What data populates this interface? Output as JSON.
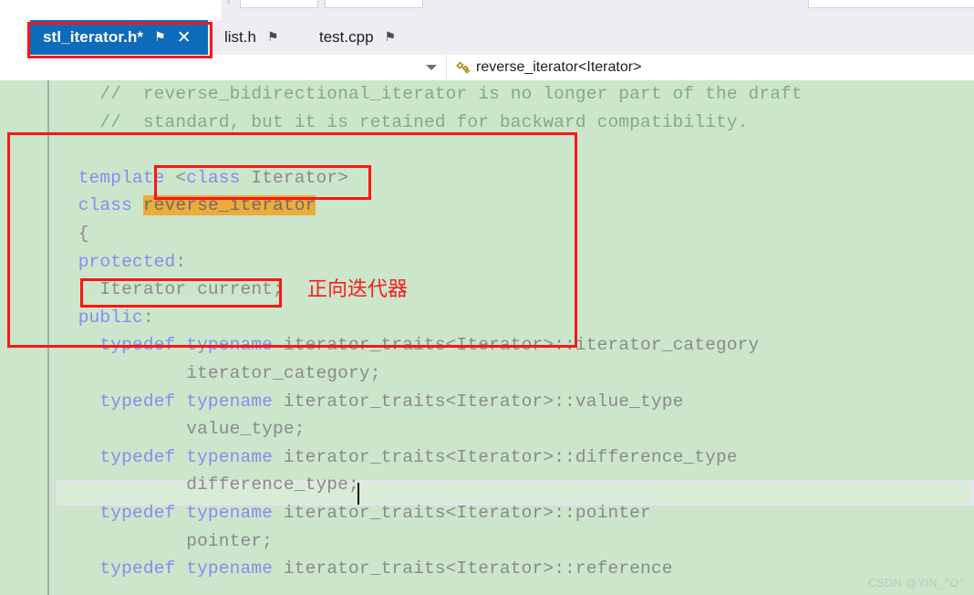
{
  "toolbar": {
    "combo_stubs": [
      "",
      "",
      ""
    ]
  },
  "tabs": {
    "items": [
      {
        "label": "stl_iterator.h*",
        "active": true,
        "pin_icon": "pin-icon",
        "close_icon": "close-icon",
        "has_close": true
      },
      {
        "label": "list.h",
        "active": false,
        "pin_icon": "pin-icon",
        "has_close": false
      },
      {
        "label": "test.cpp",
        "active": false,
        "pin_icon": "pin-icon",
        "has_close": false
      }
    ],
    "pin_glyph": "⚑",
    "close_glyph": "✕"
  },
  "navbar": {
    "scope_selector_value": "",
    "chevron_icon": "chevron-down-icon",
    "member_icon": "class-icon",
    "member_label": "reverse_iterator<Iterator>"
  },
  "editor": {
    "lines": [
      {
        "id": "l1",
        "segments": [
          {
            "t": "    //  reverse_bidirectional_iterator is no longer part of the draft",
            "c": "cmt"
          }
        ]
      },
      {
        "id": "l2",
        "segments": [
          {
            "t": "    //  standard, but it is retained for backward compatibility.",
            "c": "cmt"
          }
        ]
      },
      {
        "id": "l3",
        "segments": [
          {
            "t": "",
            "c": "id"
          }
        ]
      },
      {
        "id": "l4",
        "segments": [
          {
            "t": "  template ",
            "c": "kw"
          },
          {
            "t": "<",
            "c": "id"
          },
          {
            "t": "class",
            "c": "kw"
          },
          {
            "t": " Iterator>",
            "c": "id"
          }
        ]
      },
      {
        "id": "l5",
        "segments": [
          {
            "t": "  class ",
            "c": "kw"
          },
          {
            "t": "reverse_iterator",
            "c": "hl-orange"
          }
        ]
      },
      {
        "id": "l6",
        "segments": [
          {
            "t": "  {",
            "c": "id"
          }
        ]
      },
      {
        "id": "l7",
        "segments": [
          {
            "t": "  protected",
            "c": "kw"
          },
          {
            "t": ":",
            "c": "id"
          }
        ]
      },
      {
        "id": "l8",
        "segments": [
          {
            "t": "    Iterator current;",
            "c": "id"
          }
        ]
      },
      {
        "id": "l9",
        "segments": [
          {
            "t": "  public",
            "c": "kw"
          },
          {
            "t": ":",
            "c": "id"
          }
        ]
      },
      {
        "id": "l10",
        "segments": [
          {
            "t": "    typedef typename",
            "c": "kw"
          },
          {
            "t": " iterator_traits<Iterator>::iterator_category",
            "c": "id"
          }
        ]
      },
      {
        "id": "l11",
        "segments": [
          {
            "t": "            iterator_category;",
            "c": "id"
          }
        ]
      },
      {
        "id": "l12",
        "segments": [
          {
            "t": "    typedef typename",
            "c": "kw"
          },
          {
            "t": " iterator_traits<Iterator>::value_type",
            "c": "id"
          }
        ]
      },
      {
        "id": "l13",
        "segments": [
          {
            "t": "            value_type;",
            "c": "id"
          }
        ]
      },
      {
        "id": "l14",
        "segments": [
          {
            "t": "    typedef typename",
            "c": "kw"
          },
          {
            "t": " iterator_traits<Iterator>::difference_type",
            "c": "id"
          }
        ]
      },
      {
        "id": "l15",
        "segments": [
          {
            "t": "            difference_type;",
            "c": "id"
          }
        ]
      },
      {
        "id": "l16",
        "segments": [
          {
            "t": "    typedef typename",
            "c": "kw"
          },
          {
            "t": " iterator_traits<Iterator>::pointer",
            "c": "id"
          }
        ]
      },
      {
        "id": "l17",
        "segments": [
          {
            "t": "            pointer;",
            "c": "id"
          }
        ]
      },
      {
        "id": "l18",
        "segments": [
          {
            "t": "    typedef typename",
            "c": "kw"
          },
          {
            "t": " iterator_traits<Iterator>::reference",
            "c": "id"
          }
        ]
      }
    ],
    "highlighted_symbol": "reverse_iterator",
    "current_line_text": "            difference_type;",
    "colors": {
      "background": "#cce6cb",
      "keyword": "#8a8aee",
      "identifier": "#8a8a8a",
      "comment": "#84ab84",
      "symbol_highlight": "#edab3a",
      "current_line_fill": "#d8ecd7"
    }
  },
  "annotations": {
    "accent_color": "#f91616",
    "chinese_note": "正向迭代器",
    "boxes": [
      {
        "name": "tab-highlight"
      },
      {
        "name": "class-definition-highlight"
      },
      {
        "name": "template-parameter-highlight"
      },
      {
        "name": "current-member-highlight"
      }
    ]
  },
  "watermark": {
    "text": "CSDN @YIN_^O^"
  }
}
